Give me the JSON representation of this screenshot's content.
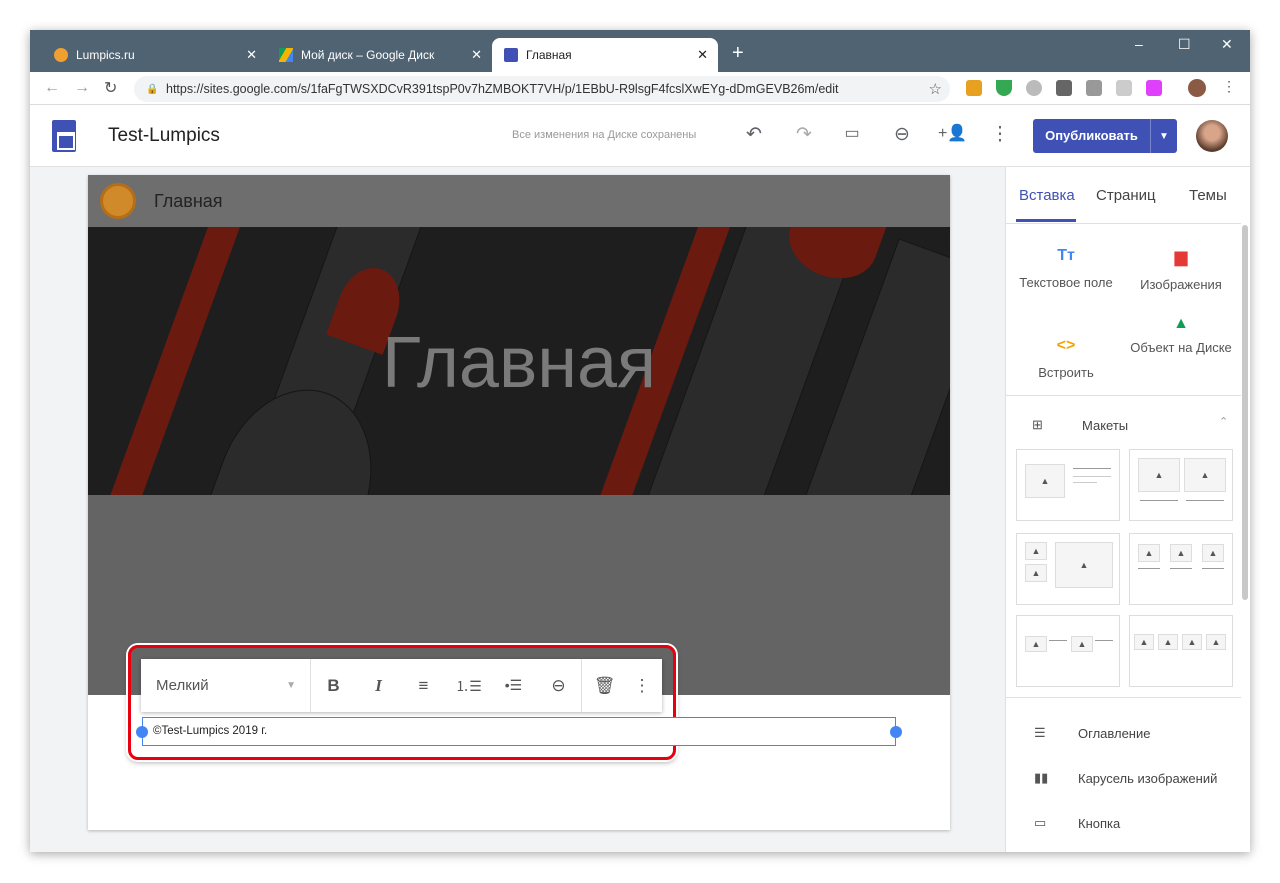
{
  "browser": {
    "tabs": [
      {
        "label": "Lumpics.ru"
      },
      {
        "label": "Мой диск – Google Диск"
      },
      {
        "label": "Главная"
      }
    ],
    "url": "https://sites.google.com/s/1faFgTWSXDCvR391tspP0v7hZMBOKT7VH/p/1EBbU-R9lsgF4fcslXwEYg-dDmGEVB26m/edit"
  },
  "header": {
    "site_title": "Test-Lumpics",
    "save_status": "Все изменения на Диске сохранены",
    "publish_label": "Опубликовать"
  },
  "page": {
    "site_name": "Главная",
    "hero_title": "Главная",
    "text_box": "©Test-Lumpics 2019 г."
  },
  "toolbar": {
    "font_size": "Мелкий"
  },
  "panel": {
    "tabs": [
      "Вставка",
      "Страниц",
      "Темы"
    ],
    "insert_items": [
      "Текстовое поле",
      "Изображения",
      "Встроить",
      "Объект на Диске"
    ],
    "layouts_label": "Макеты",
    "list_items": [
      "Оглавление",
      "Карусель изображений",
      "Кнопка"
    ]
  },
  "colors": {
    "accent": "#3f51b5",
    "selection": "#4285f4",
    "highlight": "#e8000f"
  }
}
